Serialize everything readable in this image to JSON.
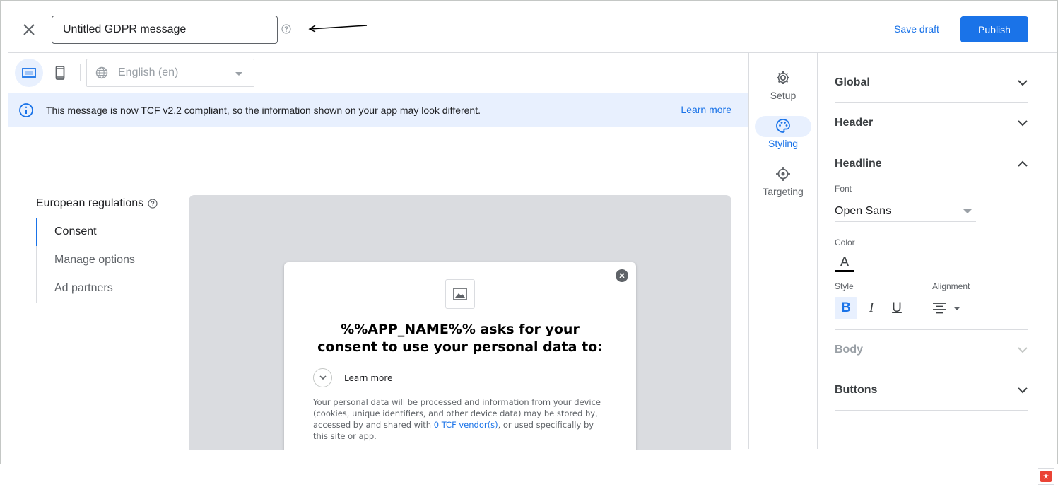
{
  "header": {
    "title_value": "Untitled GDPR message",
    "save_draft_label": "Save draft",
    "publish_label": "Publish"
  },
  "toolbar": {
    "language": "English (en)"
  },
  "banner": {
    "message": "This message is now TCF v2.2 compliant, so the information shown on your app may look different.",
    "learn_more": "Learn more"
  },
  "nav": {
    "title": "European regulations",
    "items": [
      {
        "label": "Consent",
        "active": true
      },
      {
        "label": "Manage options",
        "active": false
      },
      {
        "label": "Ad partners",
        "active": false
      }
    ]
  },
  "preview": {
    "headline": "%%APP_NAME%% asks for your consent to use your personal data to:",
    "learn_more": "Learn more",
    "body_before": "Your personal data will be processed and information from your device (cookies, unique identifiers, and other device data) may be stored by, accessed by and shared with ",
    "body_link": "0 TCF vendor(s)",
    "body_after": ", or used specifically by this site or app."
  },
  "rail": {
    "items": [
      {
        "label": "Setup",
        "icon": "gear-icon"
      },
      {
        "label": "Styling",
        "icon": "palette-icon",
        "active": true
      },
      {
        "label": "Targeting",
        "icon": "target-icon"
      }
    ]
  },
  "panel": {
    "sections": {
      "global": "Global",
      "header": "Header",
      "headline": "Headline",
      "body": "Body",
      "buttons": "Buttons"
    },
    "headline": {
      "font_label": "Font",
      "font_value": "Open Sans",
      "color_label": "Color",
      "color_glyph": "A",
      "style_label": "Style",
      "alignment_label": "Alignment",
      "bold_glyph": "B",
      "italic_glyph": "I",
      "underline_glyph": "U"
    }
  },
  "colors": {
    "accent": "#1a73e8",
    "banner_bg": "#e8f0fe",
    "preview_bg": "#dadce0"
  }
}
